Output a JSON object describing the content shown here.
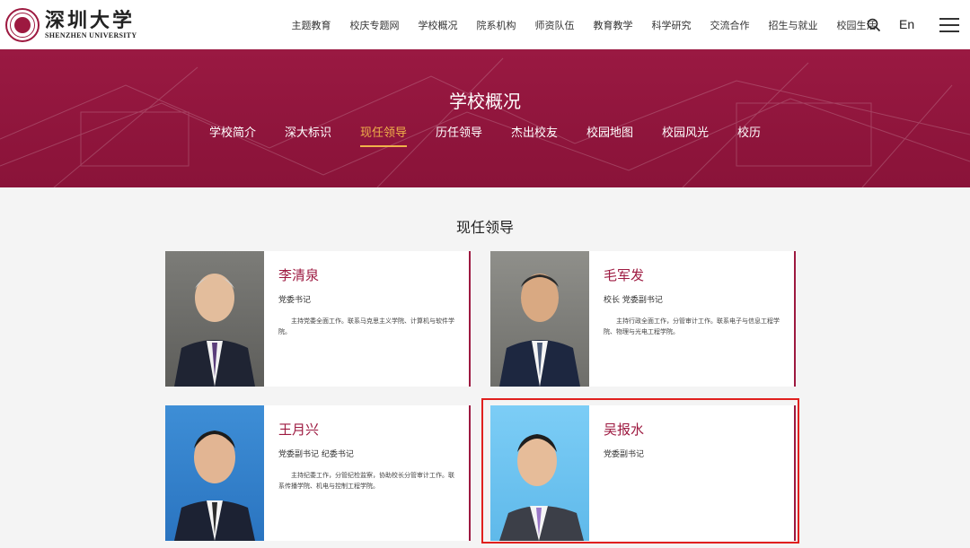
{
  "header": {
    "logo_cn": "深圳大学",
    "logo_en": "SHENZHEN UNIVERSITY",
    "lang": "En",
    "nav": [
      "主题教育",
      "校庆专题网",
      "学校概况",
      "院系机构",
      "师资队伍",
      "教育教学",
      "科学研究",
      "交流合作",
      "招生与就业",
      "校园生活"
    ]
  },
  "banner": {
    "title": "学校概况",
    "subnav": [
      "学校简介",
      "深大标识",
      "现任领导",
      "历任领导",
      "杰出校友",
      "校园地图",
      "校园风光",
      "校历"
    ],
    "active": "现任领导"
  },
  "section_title": "现任领导",
  "leaders": [
    {
      "name": "李清泉",
      "title": "党委书记",
      "desc": "主持党委全面工作。联系马克思主义学院、计算机与软件学院。"
    },
    {
      "name": "毛军发",
      "title": "校长 党委副书记",
      "desc": "主持行政全面工作，分管审计工作。联系电子与信息工程学院、物理与光电工程学院。"
    },
    {
      "name": "王月兴",
      "title": "党委副书记 纪委书记",
      "desc": "主持纪委工作，分管纪检监察，协助校长分管审计工作。联系传播学院、机电与控制工程学院。"
    },
    {
      "name": "吴报水",
      "title": "党委副书记",
      "desc": ""
    }
  ],
  "colors": {
    "brand": "#9d1940",
    "accent": "#f0b24a",
    "highlight": "#e0201e"
  }
}
